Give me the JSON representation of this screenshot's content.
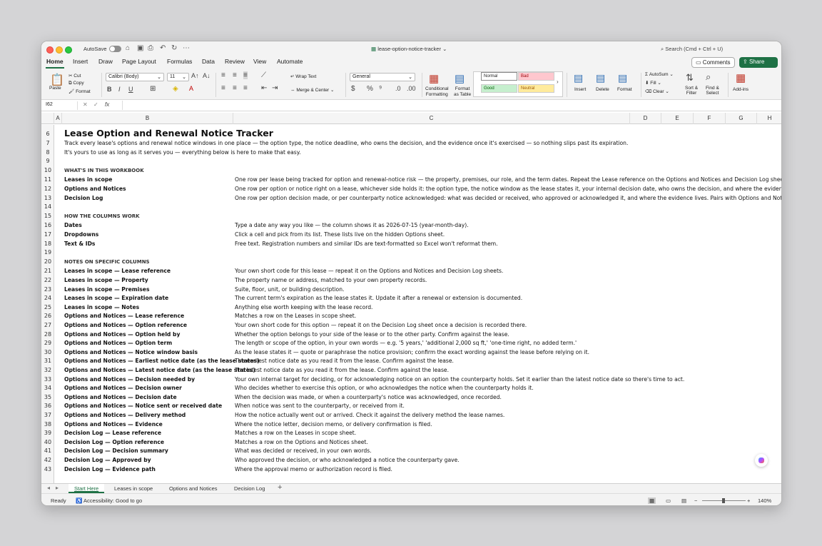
{
  "window": {
    "autosave_label": "AutoSave",
    "file_name": "lease-option-notice-tracker",
    "search_placeholder": "Search (Cmd + Ctrl + U)"
  },
  "menu": {
    "items": [
      "Home",
      "Insert",
      "Draw",
      "Page Layout",
      "Formulas",
      "Data",
      "Review",
      "View",
      "Automate"
    ],
    "comments": "Comments",
    "share": "Share"
  },
  "ribbon": {
    "paste": "Paste",
    "cut": "Cut",
    "copy": "Copy",
    "format": "Format",
    "font_name": "Calibri (Body)",
    "font_size": "11",
    "wrap_text": "Wrap Text",
    "merge_center": "Merge & Center",
    "number_format": "General",
    "conditional": "Conditional",
    "formatting": "Formatting",
    "format_as": "Format",
    "as_table": "as Table",
    "style_normal": "Normal",
    "style_bad": "Bad",
    "style_good": "Good",
    "style_neutral": "Neutral",
    "insert": "Insert",
    "delete": "Delete",
    "format_cells": "Format",
    "autosum": "AutoSum",
    "fill": "Fill",
    "clear": "Clear",
    "sort_filter_1": "Sort &",
    "sort_filter_2": "Filter",
    "find_select_1": "Find &",
    "find_select_2": "Select",
    "addins": "Add-ins"
  },
  "formula_bar": {
    "name_box": "I62",
    "fx": "fx",
    "value": ""
  },
  "columns": [
    "A",
    "B",
    "C",
    "D",
    "E",
    "F",
    "G",
    "H"
  ],
  "rows": [
    {
      "n": "6",
      "b": "Lease Option and Renewal Notice Tracker",
      "c": "",
      "style": "title"
    },
    {
      "n": "7",
      "b": "Track every lease's options and renewal notice windows in one place — the option type, the notice deadline, who owns the decision, and the evidence once it's exercised — so nothing slips past its expiration.",
      "c": "",
      "style": "normal"
    },
    {
      "n": "8",
      "b": "It's yours to use as long as it serves you — everything below is here to make that easy.",
      "c": "",
      "style": "normal"
    },
    {
      "n": "9",
      "b": "",
      "c": "",
      "style": "normal"
    },
    {
      "n": "10",
      "b": "WHAT'S IN THIS WORKBOOK",
      "c": "",
      "style": "section"
    },
    {
      "n": "11",
      "b": "Leases in scope",
      "c": "One row per lease being tracked for option and renewal-notice risk — the property, premises, our role, and the term dates. Repeat the Lease reference on the Options and Notices and Decision Log sheets to tie everything together.",
      "style": "bold"
    },
    {
      "n": "12",
      "b": "Options and Notices",
      "c": "One row per option or notice right on a lease, whichever side holds it: the option type, the notice window as the lease states it, your internal decision date, who owns the decision, and where the evidence of the decision lives.",
      "style": "bold"
    },
    {
      "n": "13",
      "b": "Decision Log",
      "c": "One row per option decision made, or per counterparty notice acknowledged: what was decided or received, who approved or acknowledged it, and where the evidence lives. Pairs with Options and Notices by Option reference.",
      "style": "bold"
    },
    {
      "n": "14",
      "b": "",
      "c": "",
      "style": "normal"
    },
    {
      "n": "15",
      "b": "HOW THE COLUMNS WORK",
      "c": "",
      "style": "section"
    },
    {
      "n": "16",
      "b": "Dates",
      "c": "Type a date any way you like — the column shows it as 2026-07-15 (year-month-day).",
      "style": "bold"
    },
    {
      "n": "17",
      "b": "Dropdowns",
      "c": "Click a cell and pick from its list. These lists live on the hidden Options sheet.",
      "style": "bold"
    },
    {
      "n": "18",
      "b": "Text & IDs",
      "c": "Free text. Registration numbers and similar IDs are text-formatted so Excel won't reformat them.",
      "style": "bold"
    },
    {
      "n": "19",
      "b": "",
      "c": "",
      "style": "normal"
    },
    {
      "n": "20",
      "b": "NOTES ON SPECIFIC COLUMNS",
      "c": "",
      "style": "section"
    },
    {
      "n": "21",
      "b": "Leases in scope — Lease reference",
      "c": "Your own short code for this lease — repeat it on the Options and Notices and Decision Log sheets.",
      "style": "bold"
    },
    {
      "n": "22",
      "b": "Leases in scope — Property",
      "c": "The property name or address, matched to your own property records.",
      "style": "bold"
    },
    {
      "n": "23",
      "b": "Leases in scope — Premises",
      "c": "Suite, floor, unit, or building description.",
      "style": "bold"
    },
    {
      "n": "24",
      "b": "Leases in scope — Expiration date",
      "c": "The current term's expiration as the lease states it. Update it after a renewal or extension is documented.",
      "style": "bold"
    },
    {
      "n": "25",
      "b": "Leases in scope — Notes",
      "c": "Anything else worth keeping with the lease record.",
      "style": "bold"
    },
    {
      "n": "26",
      "b": "Options and Notices — Lease reference",
      "c": "Matches a row on the Leases in scope sheet.",
      "style": "bold"
    },
    {
      "n": "27",
      "b": "Options and Notices — Option reference",
      "c": "Your own short code for this option — repeat it on the Decision Log sheet once a decision is recorded there.",
      "style": "bold"
    },
    {
      "n": "28",
      "b": "Options and Notices — Option held by",
      "c": "Whether the option belongs to your side of the lease or to the other party. Confirm against the lease.",
      "style": "bold"
    },
    {
      "n": "29",
      "b": "Options and Notices — Option term",
      "c": "The length or scope of the option, in your own words — e.g. '5 years,' 'additional 2,000 sq ft,' 'one-time right, no added term.'",
      "style": "bold"
    },
    {
      "n": "30",
      "b": "Options and Notices — Notice window basis",
      "c": "As the lease states it — quote or paraphrase the notice provision; confirm the exact wording against the lease before relying on it.",
      "style": "bold"
    },
    {
      "n": "31",
      "b": "Options and Notices — Earliest notice date (as the lease states)",
      "c": "The earliest notice date as you read it from the lease. Confirm against the lease.",
      "style": "bold"
    },
    {
      "n": "32",
      "b": "Options and Notices — Latest notice date (as the lease states)",
      "c": "The latest notice date as you read it from the lease. Confirm against the lease.",
      "style": "bold"
    },
    {
      "n": "33",
      "b": "Options and Notices — Decision needed by",
      "c": "Your own internal target for deciding, or for acknowledging notice on an option the counterparty holds. Set it earlier than the latest notice date so there's time to act.",
      "style": "bold"
    },
    {
      "n": "34",
      "b": "Options and Notices — Decision owner",
      "c": "Who decides whether to exercise this option, or who acknowledges the notice when the counterparty holds it.",
      "style": "bold"
    },
    {
      "n": "35",
      "b": "Options and Notices — Decision date",
      "c": "When the decision was made, or when a counterparty's notice was acknowledged, once recorded.",
      "style": "bold"
    },
    {
      "n": "36",
      "b": "Options and Notices — Notice sent or received date",
      "c": "When notice was sent to the counterparty, or received from it.",
      "style": "bold"
    },
    {
      "n": "37",
      "b": "Options and Notices — Delivery method",
      "c": "How the notice actually went out or arrived. Check it against the delivery method the lease names.",
      "style": "bold"
    },
    {
      "n": "38",
      "b": "Options and Notices — Evidence",
      "c": "Where the notice letter, decision memo, or delivery confirmation is filed.",
      "style": "bold"
    },
    {
      "n": "39",
      "b": "Decision Log — Lease reference",
      "c": "Matches a row on the Leases in scope sheet.",
      "style": "bold"
    },
    {
      "n": "40",
      "b": "Decision Log — Option reference",
      "c": "Matches a row on the Options and Notices sheet.",
      "style": "bold"
    },
    {
      "n": "41",
      "b": "Decision Log — Decision summary",
      "c": "What was decided or received, in your own words.",
      "style": "bold"
    },
    {
      "n": "42",
      "b": "Decision Log — Approved by",
      "c": "Who approved the decision, or who acknowledged a notice the counterparty gave.",
      "style": "bold"
    },
    {
      "n": "43",
      "b": "Decision Log — Evidence path",
      "c": "Where the approval memo or authorization record is filed.",
      "style": "bold"
    }
  ],
  "sheet_tabs": [
    "Start Here",
    "Leases in scope",
    "Options and Notices",
    "Decision Log"
  ],
  "status": {
    "ready": "Ready",
    "accessibility": "Accessibility: Good to go",
    "zoom": "140%"
  }
}
